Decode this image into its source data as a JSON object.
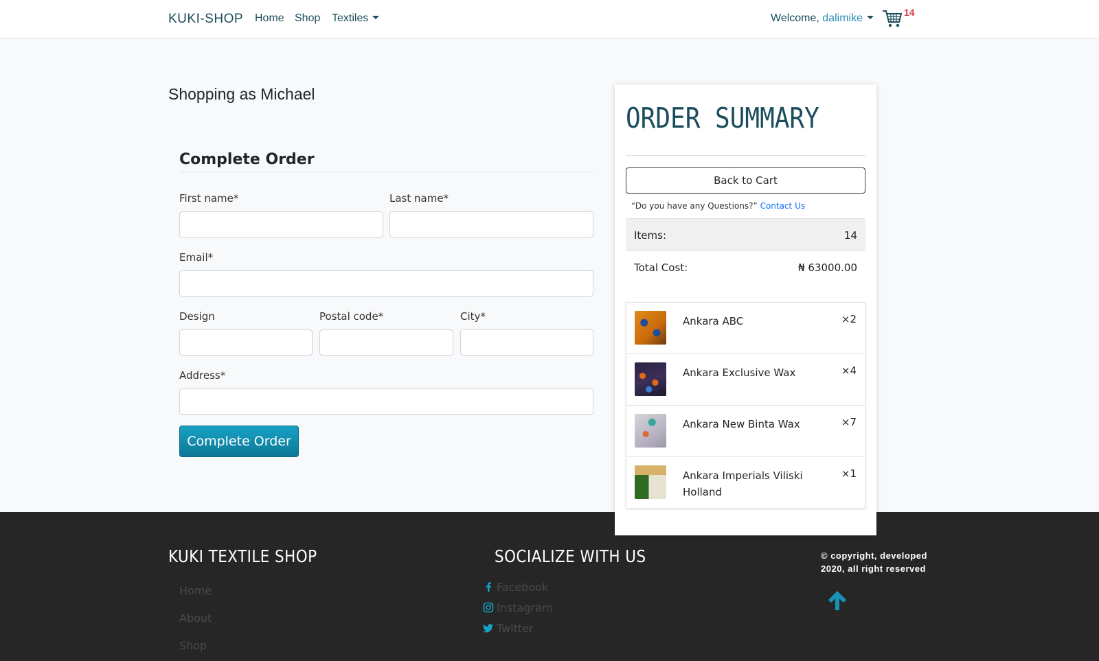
{
  "navbar": {
    "brand": "KUKI-SHOP",
    "links": [
      "Home",
      "Shop",
      "Textiles"
    ],
    "welcome_prefix": "Welcome, ",
    "username": "dalimike",
    "cart_count": "14"
  },
  "checkout": {
    "shopping_as": "Shopping as Michael",
    "form_title": "Complete Order",
    "fields": {
      "first_name": {
        "label": "First name*",
        "value": ""
      },
      "last_name": {
        "label": "Last name*",
        "value": ""
      },
      "email": {
        "label": "Email*",
        "value": ""
      },
      "design": {
        "label": "Design",
        "value": ""
      },
      "postal_code": {
        "label": "Postal code*",
        "value": ""
      },
      "city": {
        "label": "City*",
        "value": ""
      },
      "address": {
        "label": "Address*",
        "value": ""
      }
    },
    "submit_label": "Complete Order"
  },
  "summary": {
    "title": "ORDER SUMMARY",
    "back_label": "Back to Cart",
    "questions_text": "“Do you have any Questions?”",
    "contact_link": "Contact Us",
    "items_label": "Items:",
    "items_value": "14",
    "total_label": "Total Cost:",
    "total_value": "₦ 63000.00",
    "products": [
      {
        "name": "Ankara ABC",
        "qty": "×2"
      },
      {
        "name": "Ankara Exclusive Wax",
        "qty": "×4"
      },
      {
        "name": "Ankara New Binta Wax",
        "qty": "×7"
      },
      {
        "name": "Ankara Imperials Viliski Holland",
        "qty": "×1"
      }
    ]
  },
  "footer": {
    "shop_title": "KUKI TEXTILE SHOP",
    "links": [
      "Home",
      "About",
      "Shop"
    ],
    "social_title": "SOCIALIZE WITH US",
    "social": [
      "Facebook",
      "Instagram",
      "Twitter"
    ],
    "copyright_line1": "© copyright, developed",
    "copyright_line2": "2020, all right reserved"
  },
  "colors": {
    "brand_teal": "#1b4d5c",
    "accent_blue": "#2b8fb5",
    "cart_badge": "#dc3545",
    "footer_bg": "#262626",
    "button_gradient_top": "#17a2c4"
  }
}
